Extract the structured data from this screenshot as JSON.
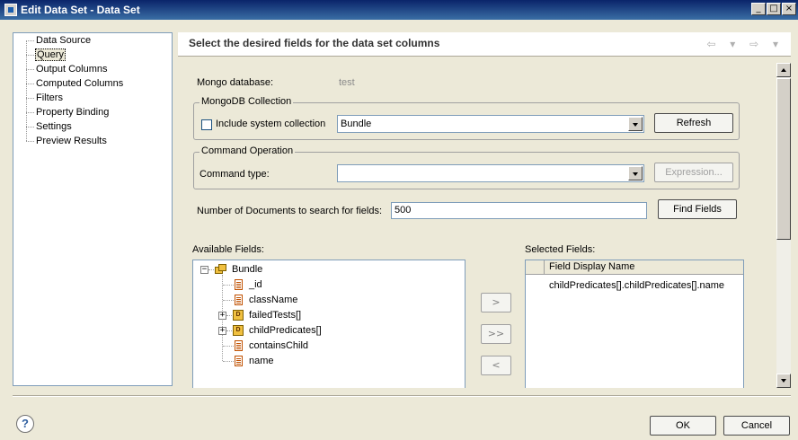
{
  "window": {
    "title": "Edit Data Set - Data Set",
    "min_glyph": "_",
    "max_glyph": "□",
    "close_glyph": "×"
  },
  "sidebar": {
    "items": [
      {
        "label": "Data Source",
        "selected": false
      },
      {
        "label": "Query",
        "selected": true
      },
      {
        "label": "Output Columns",
        "selected": false
      },
      {
        "label": "Computed Columns",
        "selected": false
      },
      {
        "label": "Filters",
        "selected": false
      },
      {
        "label": "Property Binding",
        "selected": false
      },
      {
        "label": "Settings",
        "selected": false
      },
      {
        "label": "Preview Results",
        "selected": false
      }
    ]
  },
  "header": {
    "title": "Select the desired fields for the data set columns",
    "nav_glyphs": "⇦ ▾ ⇨ ▾"
  },
  "form": {
    "mongo_db_label": "Mongo database:",
    "mongo_db_value": "test",
    "collection_group": "MongoDB Collection",
    "include_system_label": "Include system collection",
    "include_system_checked": false,
    "collection_value": "Bundle",
    "refresh_label": "Refresh",
    "command_group": "Command Operation",
    "command_type_label": "Command type:",
    "command_type_value": "",
    "expression_label": "Expression...",
    "num_docs_label": "Number of Documents to search for fields:",
    "num_docs_value": "500",
    "find_fields_label": "Find Fields"
  },
  "available": {
    "label": "Available Fields:",
    "root": "Bundle",
    "fields": [
      {
        "name": "_id",
        "type": "field",
        "expandable": false
      },
      {
        "name": "className",
        "type": "field",
        "expandable": false
      },
      {
        "name": "failedTests[]",
        "type": "object",
        "expandable": true
      },
      {
        "name": "childPredicates[]",
        "type": "object",
        "expandable": true
      },
      {
        "name": "containsChild",
        "type": "field",
        "expandable": false
      },
      {
        "name": "name",
        "type": "field",
        "expandable": false
      }
    ]
  },
  "move_buttons": {
    "add": ">",
    "add_all": ">>",
    "remove": "<"
  },
  "selected": {
    "label": "Selected Fields:",
    "column_header": "Field Display Name",
    "rows": [
      "childPredicates[].childPredicates[].name"
    ]
  },
  "footer": {
    "help_glyph": "?",
    "ok_label": "OK",
    "cancel_label": "Cancel"
  },
  "colors": {
    "title_bar": "#0a246a",
    "dialog_bg": "#ece9d8",
    "field_icon": "#c05000",
    "object_icon": "#f0c040"
  }
}
